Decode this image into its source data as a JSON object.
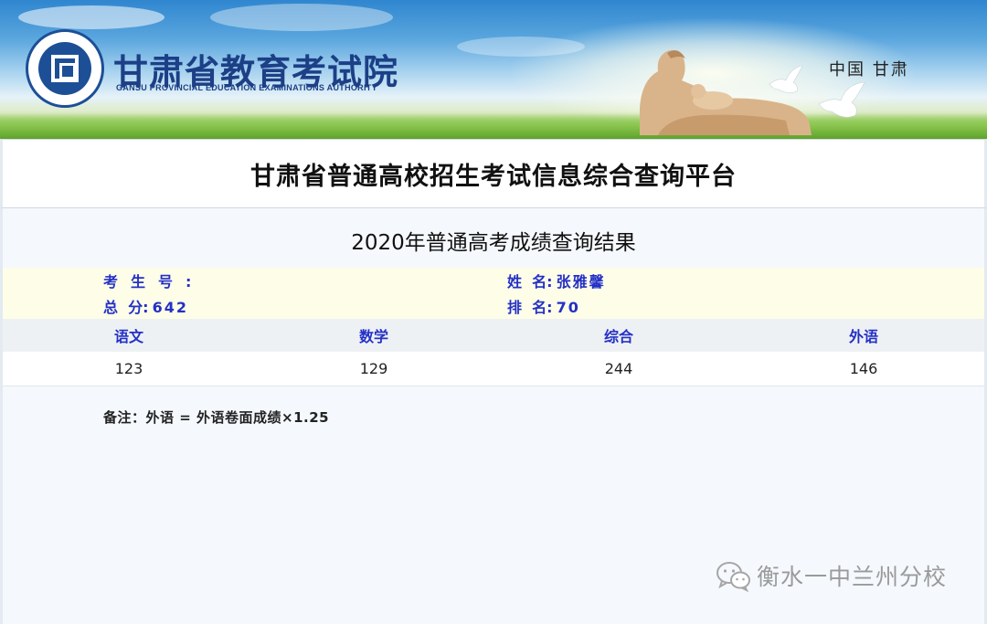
{
  "header": {
    "org_name": "甘肃省教育考试院",
    "org_name_en": "GANSU PROVINCIAL EDUCATION EXAMINATIONS AUTHORITY",
    "region": "中国 甘肃"
  },
  "platform": {
    "title": "甘肃省普通高校招生考试信息综合查询平台"
  },
  "result": {
    "title": "2020年普通高考成绩查询结果",
    "exam_id_label": "考生号",
    "exam_id_value": "",
    "name_label": "姓  名",
    "name_value": "张雅馨",
    "total_label": "总  分",
    "total_value": "642",
    "rank_label": "排  名",
    "rank_value": "70",
    "separator": ":",
    "columns": [
      "语文",
      "数学",
      "综合",
      "外语"
    ],
    "scores": [
      "123",
      "129",
      "244",
      "146"
    ],
    "note": "备注：外语 = 外语卷面成绩×1.25"
  },
  "watermark": {
    "text": "衡水一中兰州分校",
    "icon": "wechat-icon"
  },
  "colors": {
    "label_blue": "#2430c6",
    "org_blue": "#1c3f86",
    "info_bg": "#fdfde8",
    "panel_bg": "#f5f9fd"
  }
}
